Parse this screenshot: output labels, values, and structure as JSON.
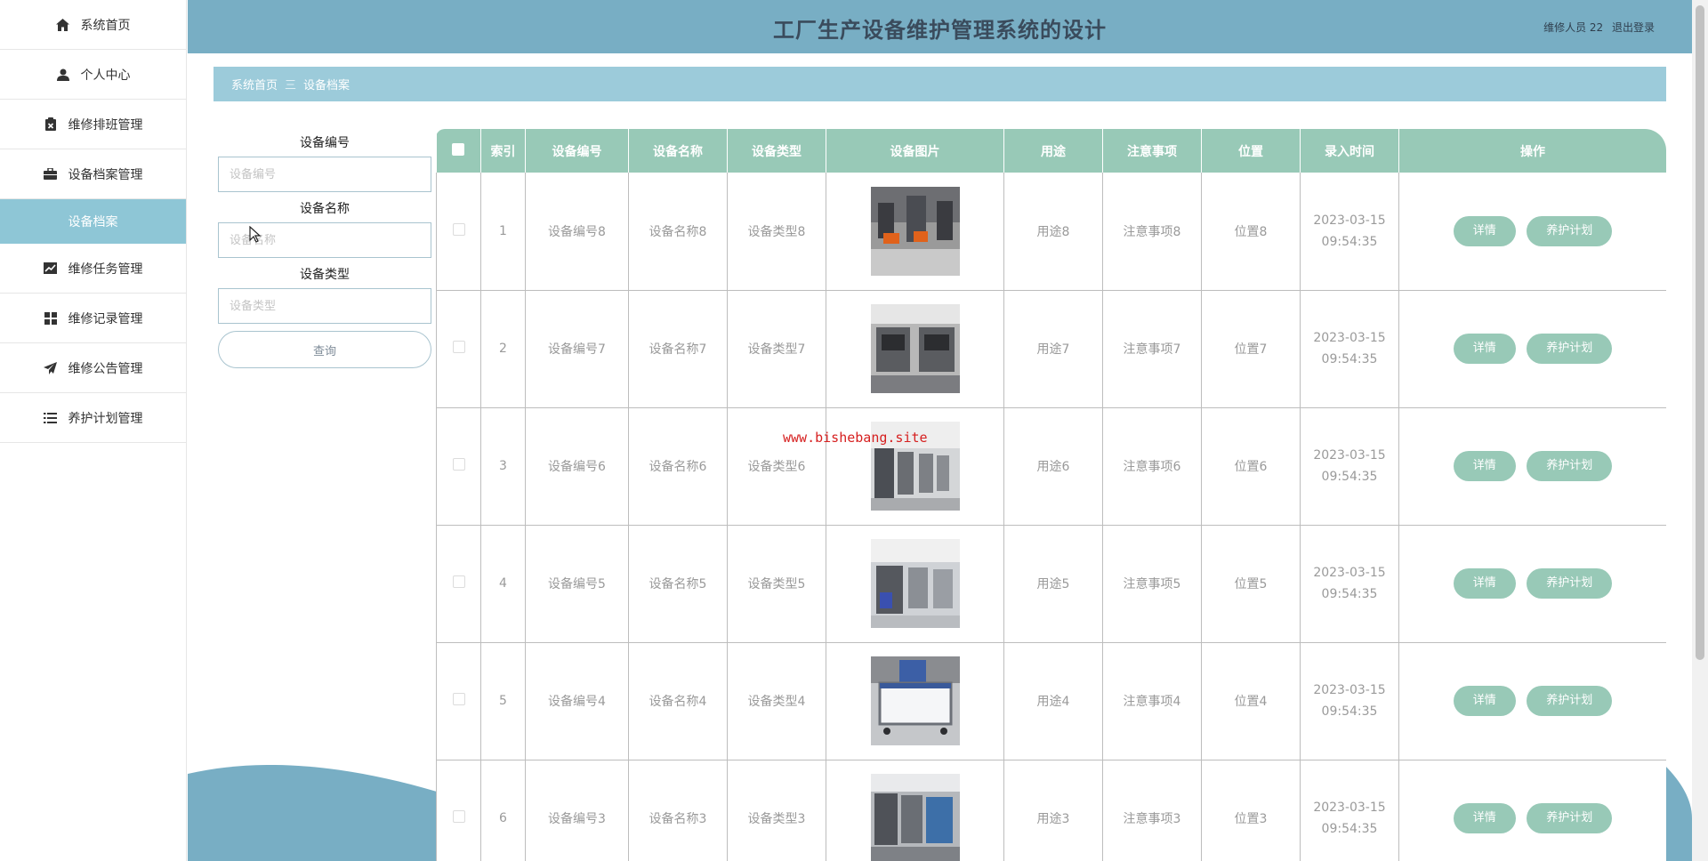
{
  "app": {
    "title": "工厂生产设备维护管理系统的设计"
  },
  "header": {
    "user": "维修人员 22",
    "logout": "退出登录"
  },
  "sidebar": {
    "items": [
      {
        "label": "系统首页",
        "icon": "home-icon"
      },
      {
        "label": "个人中心",
        "icon": "user-icon"
      },
      {
        "label": "维修排班管理",
        "icon": "clipboard-icon"
      },
      {
        "label": "设备档案管理",
        "icon": "briefcase-icon"
      },
      {
        "label": "设备档案",
        "icon": "",
        "submenu": true
      },
      {
        "label": "维修任务管理",
        "icon": "chart-icon"
      },
      {
        "label": "维修记录管理",
        "icon": "grid-icon"
      },
      {
        "label": "维修公告管理",
        "icon": "send-icon"
      },
      {
        "label": "养护计划管理",
        "icon": "list-icon"
      }
    ]
  },
  "breadcrumb": {
    "home": "系统首页",
    "separator": "三",
    "current": "设备档案"
  },
  "search": {
    "code_label": "设备编号",
    "code_placeholder": "设备编号",
    "name_label": "设备名称",
    "name_placeholder": "设备名称",
    "type_label": "设备类型",
    "type_placeholder": "设备类型",
    "button": "查询"
  },
  "table": {
    "headers": [
      "索引",
      "设备编号",
      "设备名称",
      "设备类型",
      "设备图片",
      "用途",
      "注意事项",
      "位置",
      "录入时间",
      "操作"
    ],
    "rows": [
      {
        "index": "1",
        "code": "设备编号8",
        "name": "设备名称8",
        "type": "设备类型8",
        "usage": "用途8",
        "notes": "注意事项8",
        "location": "位置8",
        "date": "2023-03-15",
        "time": "09:54:35"
      },
      {
        "index": "2",
        "code": "设备编号7",
        "name": "设备名称7",
        "type": "设备类型7",
        "usage": "用途7",
        "notes": "注意事项7",
        "location": "位置7",
        "date": "2023-03-15",
        "time": "09:54:35"
      },
      {
        "index": "3",
        "code": "设备编号6",
        "name": "设备名称6",
        "type": "设备类型6",
        "usage": "用途6",
        "notes": "注意事项6",
        "location": "位置6",
        "date": "2023-03-15",
        "time": "09:54:35"
      },
      {
        "index": "4",
        "code": "设备编号5",
        "name": "设备名称5",
        "type": "设备类型5",
        "usage": "用途5",
        "notes": "注意事项5",
        "location": "位置5",
        "date": "2023-03-15",
        "time": "09:54:35"
      },
      {
        "index": "5",
        "code": "设备编号4",
        "name": "设备名称4",
        "type": "设备类型4",
        "usage": "用途4",
        "notes": "注意事项4",
        "location": "位置4",
        "date": "2023-03-15",
        "time": "09:54:35"
      },
      {
        "index": "6",
        "code": "设备编号3",
        "name": "设备名称3",
        "type": "设备类型3",
        "usage": "用途3",
        "notes": "注意事项3",
        "location": "位置3",
        "date": "2023-03-15",
        "time": "09:54:35"
      }
    ],
    "detail_button": "详情",
    "plan_button": "养护计划"
  },
  "watermark": "www.bishebang.site",
  "colors": {
    "topbar": "#78aec4",
    "breadcrumb": "#9ccbda",
    "table_header": "#98c9b7",
    "button": "#98c9b7",
    "submenu_active": "#8ec6d6",
    "watermark": "#d62020"
  }
}
